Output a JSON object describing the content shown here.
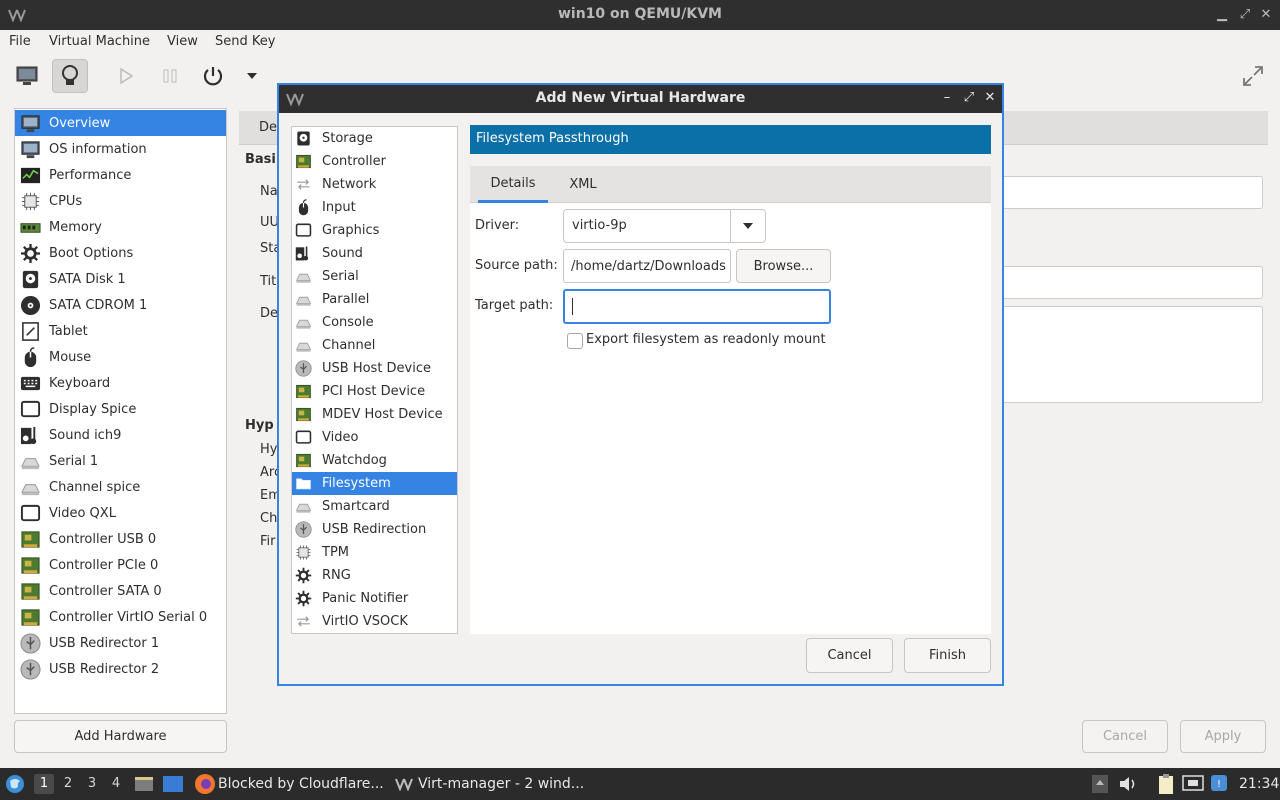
{
  "window": {
    "title": "win10 on QEMU/KVM"
  },
  "menu": [
    "File",
    "Virtual Machine",
    "View",
    "Send Key"
  ],
  "sidebar": {
    "items": [
      {
        "label": "Overview",
        "icon": "overview-icon"
      },
      {
        "label": "OS information",
        "icon": "monitor-icon"
      },
      {
        "label": "Performance",
        "icon": "performance-icon"
      },
      {
        "label": "CPUs",
        "icon": "cpu-icon"
      },
      {
        "label": "Memory",
        "icon": "memory-icon"
      },
      {
        "label": "Boot Options",
        "icon": "gear-icon"
      },
      {
        "label": "SATA Disk 1",
        "icon": "disk-icon"
      },
      {
        "label": "SATA CDROM 1",
        "icon": "cdrom-icon"
      },
      {
        "label": "Tablet",
        "icon": "tablet-icon"
      },
      {
        "label": "Mouse",
        "icon": "mouse-icon"
      },
      {
        "label": "Keyboard",
        "icon": "keyboard-icon"
      },
      {
        "label": "Display Spice",
        "icon": "display-icon"
      },
      {
        "label": "Sound ich9",
        "icon": "sound-icon"
      },
      {
        "label": "Serial 1",
        "icon": "serial-icon"
      },
      {
        "label": "Channel spice",
        "icon": "channel-icon"
      },
      {
        "label": "Video QXL",
        "icon": "video-icon"
      },
      {
        "label": "Controller USB 0",
        "icon": "controller-icon"
      },
      {
        "label": "Controller PCIe 0",
        "icon": "controller-icon"
      },
      {
        "label": "Controller SATA 0",
        "icon": "controller-icon"
      },
      {
        "label": "Controller VirtIO Serial 0",
        "icon": "controller-icon"
      },
      {
        "label": "USB Redirector 1",
        "icon": "usb-icon"
      },
      {
        "label": "USB Redirector 2",
        "icon": "usb-icon"
      }
    ],
    "add_hardware": "Add Hardware"
  },
  "details_bg": {
    "tab": "De",
    "section_basic": "Basi",
    "labels": [
      "Na",
      "UU",
      "Sta",
      "Titl",
      "De"
    ],
    "section_hyp": "Hyp",
    "hyp_labels": [
      "Hy",
      "Arc",
      "Em",
      "Ch",
      "Fir"
    ]
  },
  "bottom_buttons": {
    "cancel": "Cancel",
    "apply": "Apply"
  },
  "dialog": {
    "title": "Add New Virtual Hardware",
    "hardware_list": [
      {
        "label": "Storage",
        "icon": "storage-icon"
      },
      {
        "label": "Controller",
        "icon": "controller-icon"
      },
      {
        "label": "Network",
        "icon": "network-icon"
      },
      {
        "label": "Input",
        "icon": "mouse-icon"
      },
      {
        "label": "Graphics",
        "icon": "display-icon"
      },
      {
        "label": "Sound",
        "icon": "sound-icon"
      },
      {
        "label": "Serial",
        "icon": "serial-icon"
      },
      {
        "label": "Parallel",
        "icon": "serial-icon"
      },
      {
        "label": "Console",
        "icon": "serial-icon"
      },
      {
        "label": "Channel",
        "icon": "serial-icon"
      },
      {
        "label": "USB Host Device",
        "icon": "usb-icon"
      },
      {
        "label": "PCI Host Device",
        "icon": "controller-icon"
      },
      {
        "label": "MDEV Host Device",
        "icon": "controller-icon"
      },
      {
        "label": "Video",
        "icon": "display-icon"
      },
      {
        "label": "Watchdog",
        "icon": "controller-icon"
      },
      {
        "label": "Filesystem",
        "icon": "folder-icon"
      },
      {
        "label": "Smartcard",
        "icon": "serial-icon"
      },
      {
        "label": "USB Redirection",
        "icon": "usb-icon"
      },
      {
        "label": "TPM",
        "icon": "cpu-icon"
      },
      {
        "label": "RNG",
        "icon": "gear-icon"
      },
      {
        "label": "Panic Notifier",
        "icon": "gear-icon"
      },
      {
        "label": "VirtIO VSOCK",
        "icon": "network-icon"
      }
    ],
    "selected": "Filesystem",
    "page_title": "Filesystem Passthrough",
    "tabs": [
      "Details",
      "XML"
    ],
    "driver_label": "Driver:",
    "driver_value": "virtio-9p",
    "source_label": "Source path:",
    "source_value": "/home/dartz/Downloads",
    "browse": "Browse...",
    "target_label": "Target path:",
    "target_value": "",
    "readonly_label": "Export filesystem as readonly mount",
    "cancel": "Cancel",
    "finish": "Finish"
  },
  "taskbar": {
    "workspaces": [
      "1",
      "2",
      "3",
      "4"
    ],
    "tasks": [
      "Blocked by Cloudflare...",
      "Virt-manager - 2 wind..."
    ],
    "clock": "21:34"
  }
}
